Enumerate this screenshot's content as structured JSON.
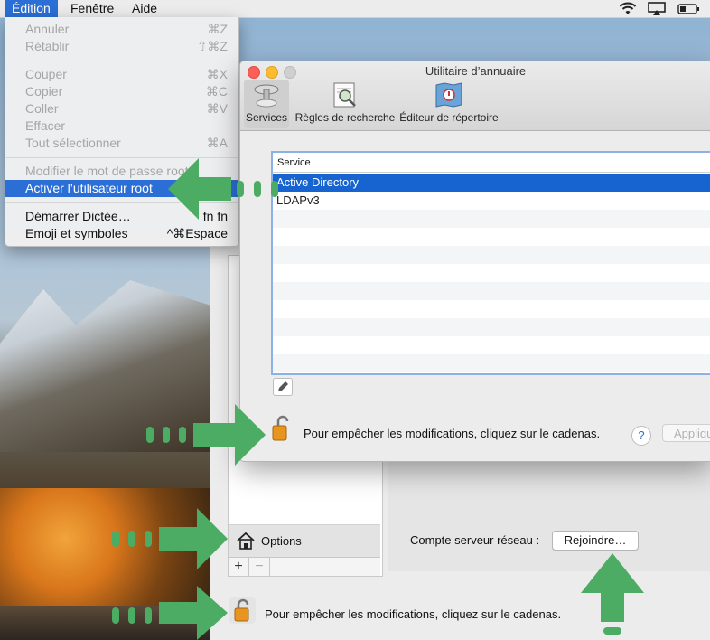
{
  "menubar": {
    "items": [
      "Édition",
      "Fenêtre",
      "Aide"
    ],
    "status_icons": [
      "wifi-icon",
      "airplay-icon",
      "battery-icon"
    ]
  },
  "edit_menu": {
    "undo": {
      "label": "Annuler",
      "shortcut": "⌘Z"
    },
    "redo": {
      "label": "Rétablir",
      "shortcut": "⇧⌘Z"
    },
    "cut": {
      "label": "Couper",
      "shortcut": "⌘X"
    },
    "copy": {
      "label": "Copier",
      "shortcut": "⌘C"
    },
    "paste": {
      "label": "Coller",
      "shortcut": "⌘V"
    },
    "delete": {
      "label": "Effacer",
      "shortcut": ""
    },
    "select_all": {
      "label": "Tout sélectionner",
      "shortcut": "⌘A"
    },
    "change_root_pw": {
      "label": "Modifier le mot de passe root",
      "shortcut": ""
    },
    "enable_root": {
      "label": "Activer l’utilisateur root",
      "shortcut": ""
    },
    "dictation": {
      "label": "Démarrer Dictée…",
      "shortcut": "fn fn"
    },
    "emoji": {
      "label": "Emoji et symboles",
      "shortcut": "^⌘Espace"
    }
  },
  "directory_utility": {
    "title": "Utilitaire d’annuaire",
    "toolbar": {
      "services": "Services",
      "search_rules": "Règles de recherche",
      "directory_editor": "Éditeur de répertoire"
    },
    "table": {
      "header": "Service",
      "rows": [
        "Active Directory",
        "LDAPv3"
      ]
    },
    "lock_text": "Pour empêcher les modifications, cliquez sur le cadenas.",
    "help_label": "?",
    "apply_label": "Appliquer"
  },
  "users_groups": {
    "options_label": "Options",
    "add_label": "+",
    "remove_label": "−",
    "network_account_label": "Compte serveur réseau :",
    "join_button": "Rejoindre…",
    "lock_text": "Pour empêcher les modifications, cliquez sur le cadenas."
  },
  "colors": {
    "accent": "#2b6fd6",
    "annotation_green": "#4cac63"
  }
}
